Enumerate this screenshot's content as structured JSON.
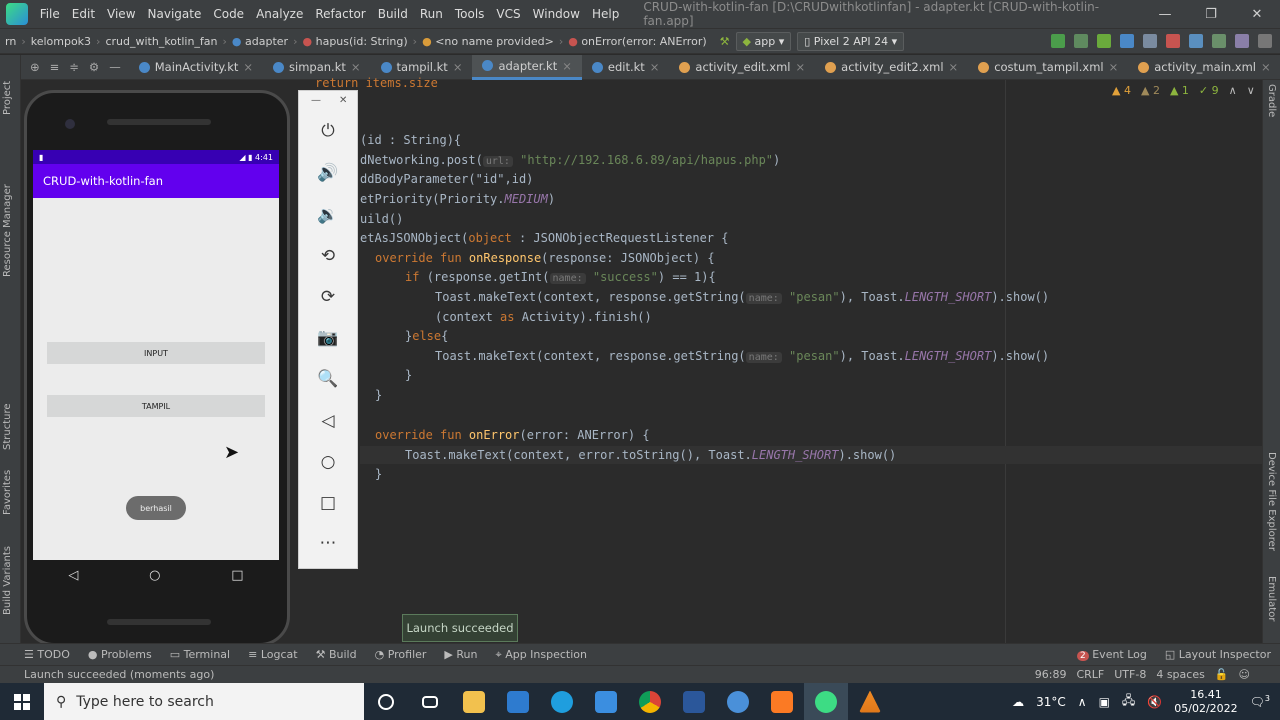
{
  "menu": {
    "items": [
      "File",
      "Edit",
      "View",
      "Navigate",
      "Code",
      "Analyze",
      "Refactor",
      "Build",
      "Run",
      "Tools",
      "VCS",
      "Window",
      "Help"
    ],
    "window_title": "CRUD-with-kotlin-fan [D:\\CRUDwithkotlinfan] - adapter.kt [CRUD-with-kotlin-fan.app]"
  },
  "breadcrumb": {
    "items": [
      "rn",
      "kelompok3",
      "crud_with_kotlin_fan",
      "adapter",
      "hapus(id: String)",
      "<no name provided>",
      "onError(error: ANError)"
    ],
    "run_config": "app",
    "device": "Pixel 2 API 24"
  },
  "tabs": [
    {
      "label": "MainActivity.kt",
      "active": false,
      "color": "#4a88c7"
    },
    {
      "label": "simpan.kt",
      "active": false,
      "color": "#4a88c7"
    },
    {
      "label": "tampil.kt",
      "active": false,
      "color": "#4a88c7"
    },
    {
      "label": "adapter.kt",
      "active": true,
      "color": "#4a88c7"
    },
    {
      "label": "edit.kt",
      "active": false,
      "color": "#4a88c7"
    },
    {
      "label": "activity_edit.xml",
      "active": false,
      "color": "#e0a050"
    },
    {
      "label": "activity_edit2.xml",
      "active": false,
      "color": "#e0a050"
    },
    {
      "label": "costum_tampil.xml",
      "active": false,
      "color": "#e0a050"
    },
    {
      "label": "activity_main.xml",
      "active": false,
      "color": "#e0a050"
    }
  ],
  "left_tool_windows": [
    "Project",
    "Resource Manager",
    "Structure",
    "Favorites",
    "Build Variants"
  ],
  "right_tool_windows": [
    "Gradle",
    "Device File Explorer",
    "Emulator"
  ],
  "inspection": {
    "warnings": "4",
    "weak_warnings": "2",
    "typos": "1",
    "ok": "9"
  },
  "code": {
    "line0": "return items.size",
    "line1": "(id : String){",
    "line2_a": "dNetworking.post(",
    "line2_hint": "url:",
    "line2_str": "\"http://192.168.6.89/api/hapus.php\"",
    "line2_b": ")",
    "line3": "ddBodyParameter(\"id\",id)",
    "line4_a": "etPriority(Priority.",
    "line4_it": "MEDIUM",
    "line4_b": ")",
    "line5": "uild()",
    "line6_a": "etAsJSONObject(",
    "line6_kw": "object",
    "line6_b": " : JSONObjectRequestListener {",
    "line7_kw": "override fun ",
    "line7_fn": "onResponse",
    "line7_b": "(response: JSONObject) {",
    "line8_kw": "if ",
    "line8_a": "(response.getInt(",
    "line8_hint": "name:",
    "line8_str": "\"success\"",
    "line8_b": ") == 1){",
    "line9_a": "Toast.makeText(context, response.getString(",
    "line9_hint": "name:",
    "line9_str": "\"pesan\"",
    "line9_b": "), Toast.",
    "line9_it": "LENGTH_SHORT",
    "line9_c": ").show()",
    "line10_a": "(context ",
    "line10_kw": "as",
    "line10_b": " Activity).finish()",
    "line11_a": "}",
    "line11_kw": "else",
    "line11_b": "{",
    "line12_a": "Toast.makeText(context, response.getString(",
    "line12_hint": "name:",
    "line12_str": "\"pesan\"",
    "line12_b": "), Toast.",
    "line12_it": "LENGTH_SHORT",
    "line12_c": ").show()",
    "line13": "}",
    "line14": "}",
    "line15_kw": "override fun ",
    "line15_fn": "onError",
    "line15_b": "(error: ANError) {",
    "line16_a": "Toast.makeText(context, error.toString(), Toast.",
    "line16_it": "LENGTH_SHORT",
    "line16_b": ").show()",
    "line17": "}"
  },
  "emulator": {
    "status_time": "4:41",
    "app_title": "CRUD-with-kotlin-fan",
    "button_input": "INPUT",
    "button_tampil": "TAMPIL",
    "toast": "berhasil",
    "nav_back": "◁",
    "nav_home": "○",
    "nav_recent": "□"
  },
  "emulator_controls": [
    "power-icon",
    "volume-up-icon",
    "volume-down-icon",
    "rotate-left-icon",
    "rotate-right-icon",
    "camera-icon",
    "zoom-icon",
    "back-icon",
    "home-icon",
    "overview-icon",
    "more-icon"
  ],
  "launch_popup": "Launch succeeded",
  "bottom_tools": [
    "TODO",
    "Problems",
    "Terminal",
    "Logcat",
    "Build",
    "Profiler",
    "Run",
    "App Inspection"
  ],
  "bottom_tools_right": [
    "Event Log",
    "Layout Inspector"
  ],
  "event_log_count": "2",
  "status": {
    "message": "Launch succeeded (moments ago)",
    "position": "96:89",
    "line_sep": "CRLF",
    "encoding": "UTF-8",
    "indent": "4 spaces"
  },
  "taskbar": {
    "search_placeholder": "Type here to search",
    "weather": "31°C",
    "time": "16.41",
    "date": "05/02/2022",
    "notification_count": "3"
  }
}
